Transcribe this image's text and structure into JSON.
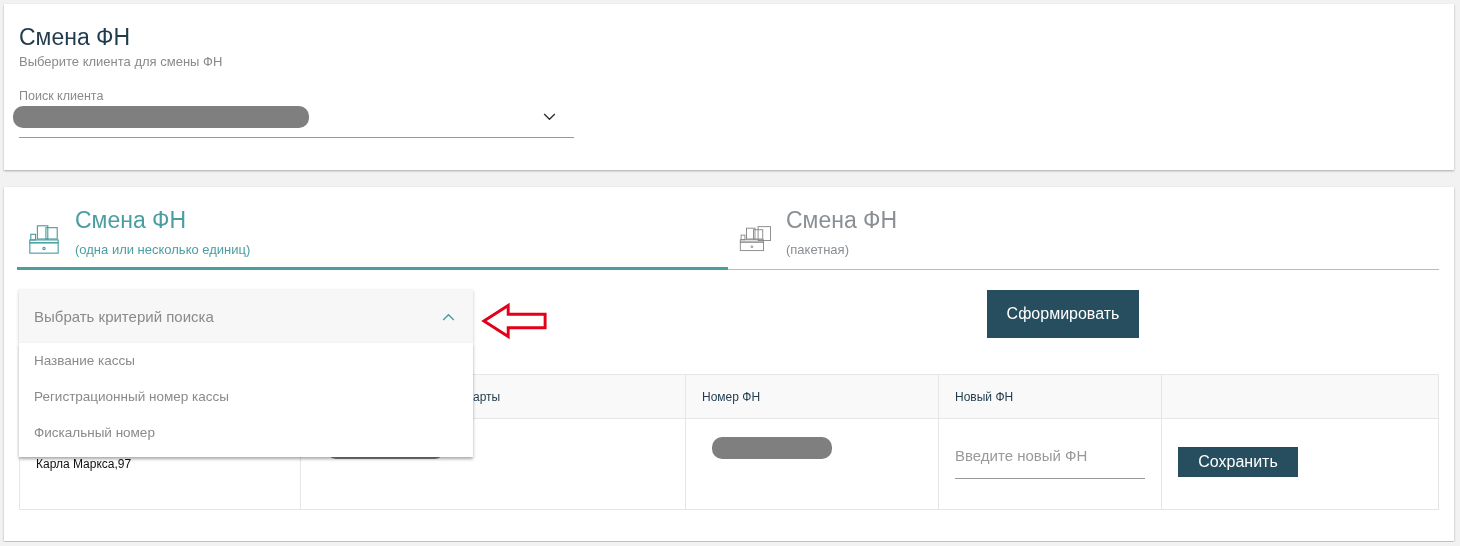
{
  "header": {
    "title": "Смена ФН",
    "subtitle": "Выберите клиента для смены ФН",
    "client_search": {
      "label": "Поиск клиента",
      "value_redacted": true
    }
  },
  "tabs": [
    {
      "title": "Смена ФН",
      "subtitle": "(одна или несколько единиц)",
      "selected": true,
      "kind": "single"
    },
    {
      "title": "Смена ФН",
      "subtitle": "(пакетная)",
      "selected": false,
      "kind": "batch"
    }
  ],
  "criteria_dropdown": {
    "placeholder": "Выбрать критерий поиска",
    "expanded": true,
    "options": [
      "Название кассы",
      "Регистрационный номер кассы",
      "Фискальный номер"
    ]
  },
  "generate_button": "Сформировать",
  "table": {
    "columns": [
      "",
      "арты",
      "Номер ФН",
      "Новый ФН",
      ""
    ],
    "rows": [
      {
        "address": "Карла Маркса,97",
        "new_fn_placeholder": "Введите новый ФН",
        "save_button": "Сохранить"
      }
    ]
  }
}
